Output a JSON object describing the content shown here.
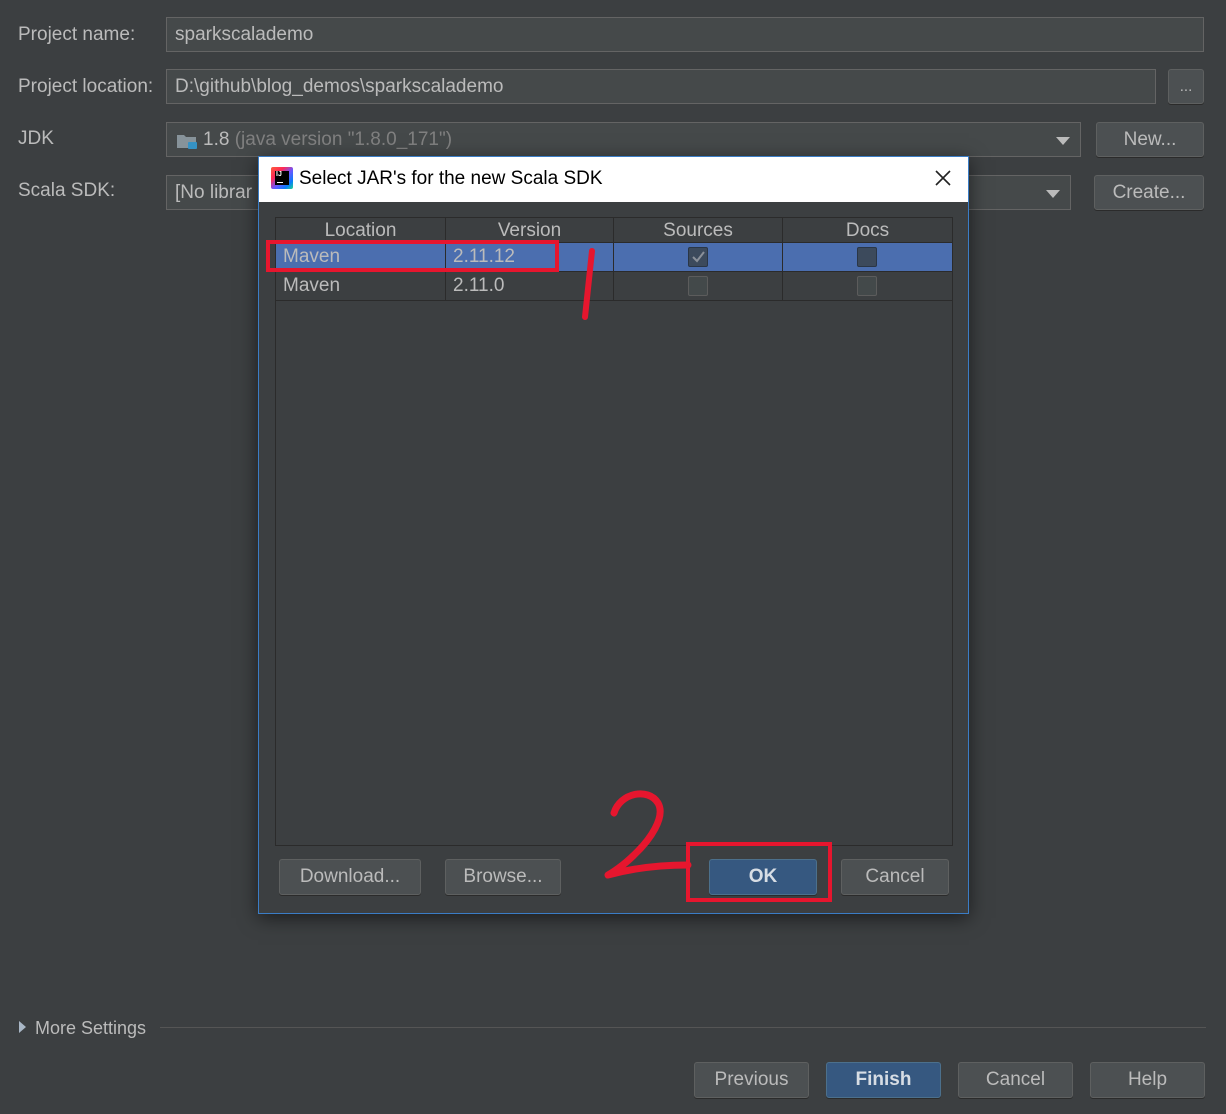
{
  "form": {
    "project_name_label": "Project name:",
    "project_name_value": "sparkscalademo",
    "project_location_label": "Project location:",
    "project_location_value": "D:\\github\\blog_demos\\sparkscalademo",
    "browse_button": "...",
    "jdk_label": "JDK",
    "jdk_version": "1.8",
    "jdk_detail": "(java version \"1.8.0_171\")",
    "jdk_new_button": "New...",
    "scala_sdk_label": "Scala SDK:",
    "scala_sdk_value": "[No librar",
    "scala_create_button": "Create..."
  },
  "more_settings": "More Settings",
  "footer": {
    "previous": "Previous",
    "finish": "Finish",
    "cancel": "Cancel",
    "help": "Help"
  },
  "dialog": {
    "title": "Select JAR's for the new Scala SDK",
    "columns": [
      "Location",
      "Version",
      "Sources",
      "Docs"
    ],
    "rows": [
      {
        "location": "Maven",
        "version": "2.11.12",
        "sources": true,
        "docs": false,
        "selected": true
      },
      {
        "location": "Maven",
        "version": "2.11.0",
        "sources": false,
        "docs": false,
        "selected": false
      }
    ],
    "download_button": "Download...",
    "browse_button": "Browse...",
    "ok_button": "OK",
    "cancel_button": "Cancel"
  },
  "annotations": {
    "label_1": "1",
    "label_2": "2",
    "color": "#e6162e"
  },
  "colors": {
    "background": "#3c3f41",
    "selection": "#4b6eaf",
    "default_button": "#365880",
    "dialog_border": "#3b7dc6"
  }
}
